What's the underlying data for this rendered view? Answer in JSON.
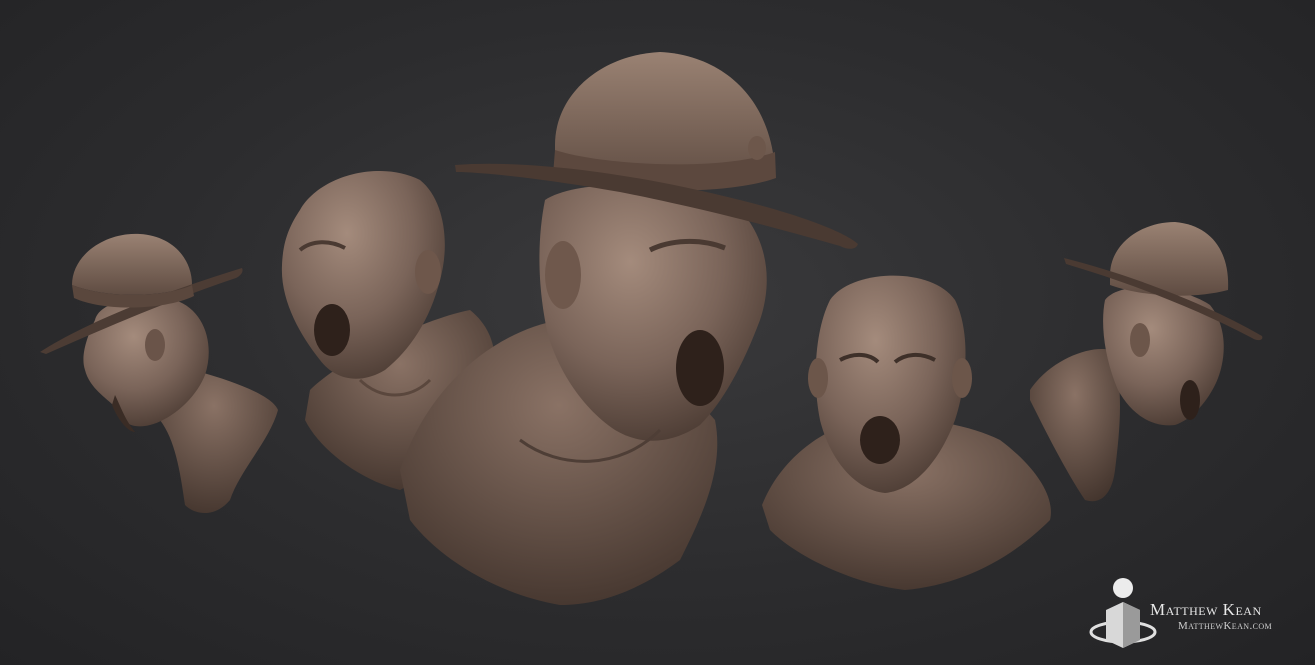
{
  "scene": {
    "subject": "sculpted drill sergeant bust, five views",
    "colors": {
      "background": "#2c2c2e",
      "clay": "#7a6459",
      "clay_light": "#9c8476",
      "clay_dark": "#4e3e36"
    }
  },
  "views": [
    {
      "id": "left-profile-hat",
      "hat": true
    },
    {
      "id": "three-quarter-bald",
      "hat": false
    },
    {
      "id": "center-hat",
      "hat": true
    },
    {
      "id": "front-bald",
      "hat": false
    },
    {
      "id": "right-profile-hat",
      "hat": true
    }
  ],
  "watermark": {
    "name": "Matthew Kean",
    "url": "MatthewKean.com"
  }
}
